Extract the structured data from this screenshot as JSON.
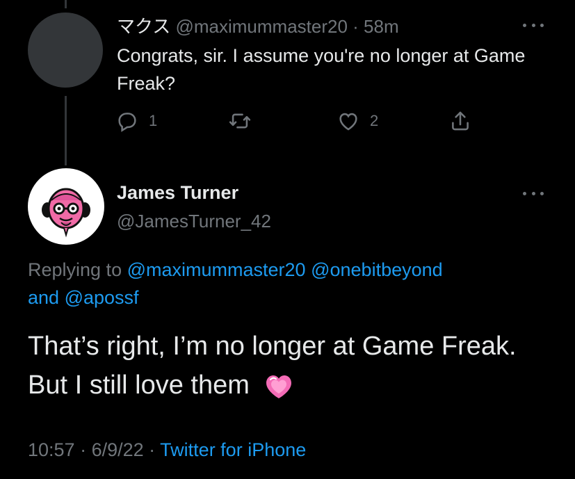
{
  "tweet1": {
    "display_name": "マクス",
    "handle": "@maximummaster20",
    "separator": " · ",
    "time": "58m",
    "text": "Congrats, sir. I assume you're no longer at Game Freak?",
    "reply_count": "1",
    "like_count": "2",
    "icons": [
      "reply-icon",
      "retweet-icon",
      "like-icon",
      "share-icon",
      "more-icon"
    ]
  },
  "tweet2": {
    "display_name": "James Turner",
    "handle": "@JamesTurner_42",
    "replying_prefix": "Replying to",
    "mention1": "@maximummaster20",
    "mention2": "@onebitbeyond",
    "and_text": "and",
    "mention3": "@apossf",
    "text": "That’s right, I’m no longer at Game Freak. But I still love them",
    "emoji": "heart-emoji",
    "time": "10:57",
    "dot": " · ",
    "date": "6/9/22",
    "source": "Twitter for iPhone"
  },
  "colors": {
    "background": "#000000",
    "text": "#e7e9ea",
    "muted": "#71767b",
    "link": "#1d9bf0",
    "thread_line": "#333639",
    "avatar_pink": "#f06aa6"
  }
}
